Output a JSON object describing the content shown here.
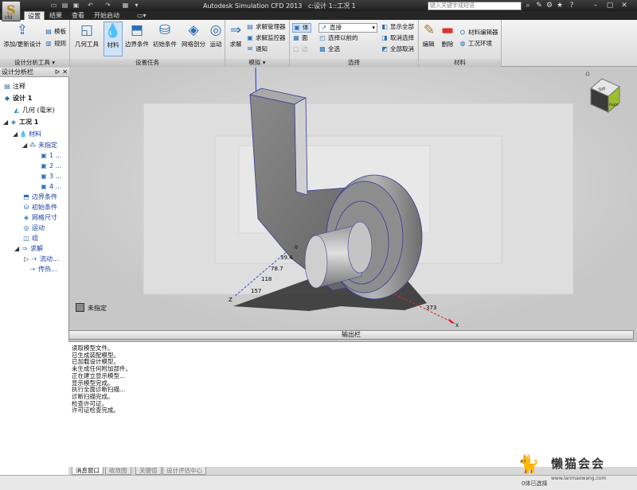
{
  "titlebar": {
    "app_title": "Autodesk Simulation CFD 2013",
    "doc_title": "c:设计 1::工况 1",
    "search_placeholder": "键入关键字或短语"
  },
  "tabs": [
    "设置",
    "结果",
    "查看",
    "开始启动"
  ],
  "active_tab": 0,
  "ribbon": {
    "groups": [
      {
        "label": "设计分析工具",
        "items": [
          "添加/更新设计",
          "模板",
          "规则"
        ]
      },
      {
        "label": "设置任务",
        "items": [
          "几何工具",
          "材料",
          "边界条件",
          "初始条件",
          "网格剖分",
          "运动"
        ]
      },
      {
        "label": "模拟",
        "items": [
          "求解",
          "求解管理器",
          "求解监控器",
          "通知"
        ]
      },
      {
        "label": "选择",
        "items": [
          "体",
          "面",
          "边",
          "直接",
          "选择以前的",
          "全选",
          "显示全部",
          "取消选择",
          "全部取消"
        ]
      },
      {
        "label": "材料",
        "items": [
          "编辑",
          "删除",
          "材料编辑器",
          "工况环境"
        ]
      }
    ]
  },
  "sidebar": {
    "title": "设计分析栏",
    "items": [
      "注释",
      "设计 1",
      "几何 (毫米)",
      "工况 1",
      "材料",
      "未指定",
      "1 ...",
      "2 ...",
      "3 ...",
      "4 ...",
      "边界条件",
      "初始条件",
      "网格尺寸",
      "运动",
      "组",
      "求解",
      "流动...",
      "传热..."
    ]
  },
  "viewport": {
    "ticks_z": [
      "39.4",
      "78.7",
      "118",
      "157"
    ],
    "tick_x": "373",
    "axis_x": "X",
    "axis_z": "Z",
    "axis_zero": "0",
    "legend": "未指定",
    "viewcube_face": "Top",
    "viewcube_right": "Right"
  },
  "output": {
    "title": "输出栏",
    "lines": [
      "读取模型文件。",
      "已生成装配模型。",
      "已加载设计模型。",
      "未生成任何附加部件。",
      "正在建立显示模型...",
      "显示模型完成。",
      "执行全面诊断扫描...",
      "诊断扫描完成。",
      "检查许可证。",
      "许可证检查完成。"
    ]
  },
  "bottom_tabs": [
    "消息窗口",
    "收敛图",
    "关键值",
    "设计评估中心"
  ],
  "status": {
    "text": "0体已选择",
    "watermark": "懒猫会会",
    "watermark_url": "www.lanmaowang.com"
  }
}
